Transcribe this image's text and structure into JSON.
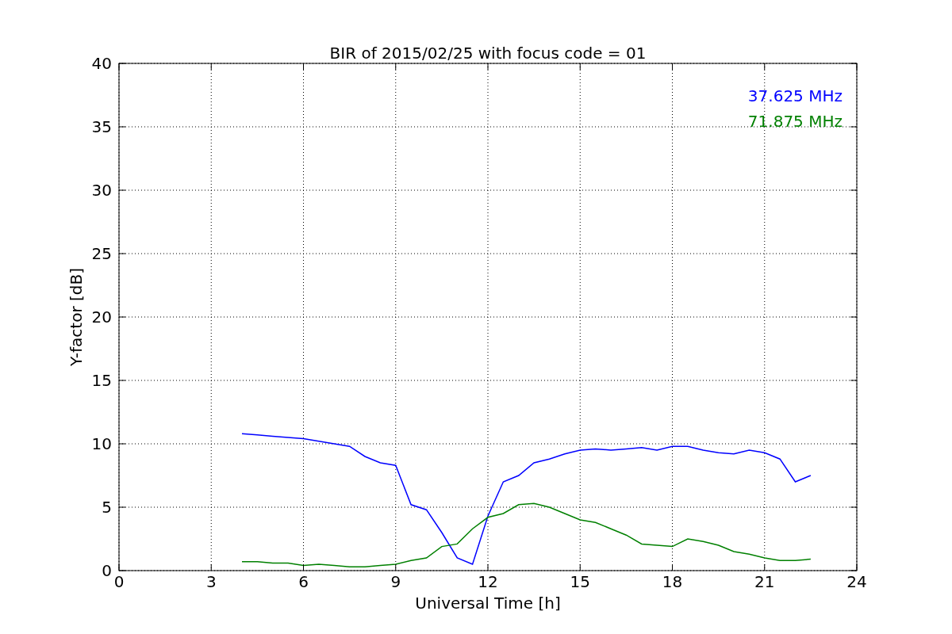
{
  "chart_data": {
    "type": "line",
    "title": "BIR of 2015/02/25 with focus code = 01",
    "xlabel": "Universal Time [h]",
    "ylabel": "Y-factor [dB]",
    "x": [
      4,
      4.5,
      5,
      5.5,
      6,
      6.5,
      7,
      7.5,
      8,
      8.5,
      9,
      9.5,
      10,
      10.5,
      11,
      11.5,
      12,
      12.5,
      13,
      13.5,
      14,
      14.5,
      15,
      15.5,
      16,
      16.5,
      17,
      17.5,
      18,
      18.5,
      19,
      19.5,
      20,
      20.5,
      21,
      21.5,
      22,
      22.5
    ],
    "series": [
      {
        "name": "37.625 MHz",
        "color": "#0000ff",
        "values": [
          10.8,
          10.7,
          10.6,
          10.5,
          10.4,
          10.2,
          10.0,
          9.8,
          9.0,
          8.5,
          8.3,
          5.2,
          4.8,
          3.0,
          1.0,
          0.5,
          4.3,
          7.0,
          7.5,
          8.5,
          8.8,
          9.2,
          9.5,
          9.6,
          9.5,
          9.6,
          9.7,
          9.5,
          9.8,
          9.8,
          9.5,
          9.3,
          9.2,
          9.5,
          9.3,
          8.8,
          7.0,
          7.5
        ]
      },
      {
        "name": "71.875 MHz",
        "color": "#008000",
        "values": [
          0.7,
          0.7,
          0.6,
          0.6,
          0.4,
          0.5,
          0.4,
          0.3,
          0.3,
          0.4,
          0.5,
          0.8,
          1.0,
          1.9,
          2.1,
          3.3,
          4.2,
          4.5,
          5.2,
          5.3,
          5.0,
          4.5,
          4.0,
          3.8,
          3.3,
          2.8,
          2.1,
          2.0,
          1.9,
          2.5,
          2.3,
          2.0,
          1.5,
          1.3,
          1.0,
          0.8,
          0.8,
          0.9
        ]
      }
    ],
    "grid": true,
    "xlim": [
      0,
      24
    ],
    "ylim": [
      0,
      40
    ],
    "xticks": [
      0,
      3,
      6,
      9,
      12,
      15,
      18,
      21,
      24
    ],
    "yticks": [
      0,
      5,
      10,
      15,
      20,
      25,
      30,
      35,
      40
    ]
  }
}
